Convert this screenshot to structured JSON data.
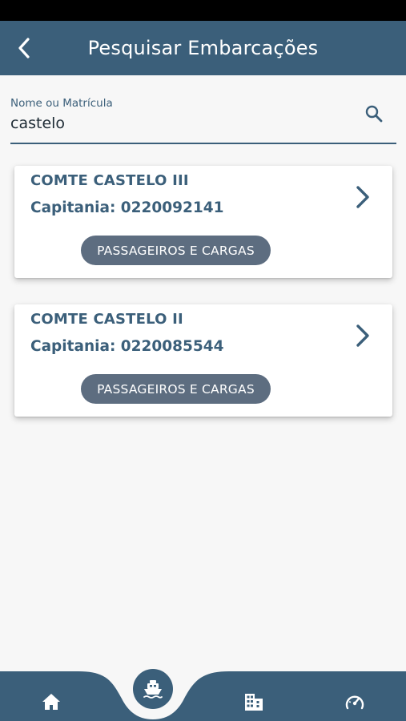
{
  "header": {
    "title": "Pesquisar Embarcações",
    "back_icon": "chevron-left-icon"
  },
  "search": {
    "label": "Nome ou Matrícula",
    "value": "castelo",
    "icon": "search-icon"
  },
  "results": [
    {
      "name": "COMTE CASTELO III",
      "registration": "Capitania: 0220092141",
      "category": "PASSAGEIROS E CARGAS"
    },
    {
      "name": "COMTE CASTELO II",
      "registration": "Capitania: 0220085544",
      "category": "PASSAGEIROS E CARGAS"
    }
  ],
  "bottom_nav": {
    "items": [
      "home-icon",
      "boat-icon",
      "building-icon",
      "speedometer-icon"
    ],
    "active": "boat-icon"
  },
  "colors": {
    "primary": "#3b5f7a",
    "badge": "#5d6d80",
    "background": "#f7f7f7",
    "status_bar": "#000000"
  }
}
